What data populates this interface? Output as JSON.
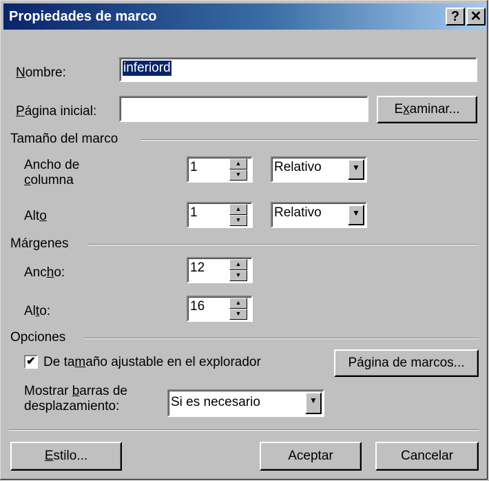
{
  "window": {
    "title": "Propiedades de marco",
    "help_button": "?",
    "close_button": "✕"
  },
  "nombre": {
    "label_u": "N",
    "label_rest": "ombre:",
    "value": "inferiord"
  },
  "pagina_inicial": {
    "label_u": "P",
    "label_rest": "ágina inicial:",
    "value": "",
    "browse_pre": "E",
    "browse_u": "x",
    "browse_post": "aminar..."
  },
  "tamano": {
    "group_label": "Tamaño del marco",
    "ancho_line1": "Ancho de",
    "ancho_line2_u": "c",
    "ancho_line2_rest": "olumna",
    "ancho_value": "1",
    "ancho_unit": "Relativo",
    "alto_pre": "Alt",
    "alto_u": "o",
    "alto_value": "1",
    "alto_unit": "Relativo"
  },
  "margenes": {
    "group_label": "Márgenes",
    "ancho_pre": "Anc",
    "ancho_u": "h",
    "ancho_post": "o:",
    "ancho_value": "12",
    "alto_pre": "Al",
    "alto_u": "t",
    "alto_post": "o:",
    "alto_value": "16"
  },
  "opciones": {
    "group_label": "Opciones",
    "resizable_pre": "De ta",
    "resizable_u": "m",
    "resizable_post": "año ajustable en el explorador",
    "resizable_checked": "✔",
    "frames_pre": "Pá",
    "frames_u": "g",
    "frames_post": "ina de marcos...",
    "scroll_line1_pre": "Mostrar ",
    "scroll_line1_u": "b",
    "scroll_line1_post": "arras de",
    "scroll_line2": "desplazamiento:",
    "scroll_value": "Si es necesario"
  },
  "buttons": {
    "style_u": "E",
    "style_rest": "stilo...",
    "ok": "Aceptar",
    "cancel": "Cancelar"
  },
  "icons": {
    "spin_up": "▲",
    "spin_down": "▼",
    "dropdown": "▼"
  }
}
